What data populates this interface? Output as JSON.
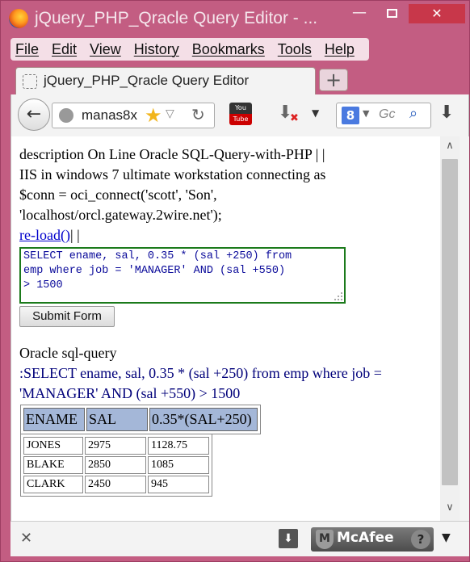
{
  "window": {
    "title": "jQuery_PHP_Qracle Query Editor - ...",
    "minimize": "—",
    "close": "✕"
  },
  "menu": {
    "items": [
      "File",
      "Edit",
      "View",
      "History",
      "Bookmarks",
      "Tools",
      "Help"
    ]
  },
  "tab": {
    "title": "jQuery_PHP_Qracle Query Editor",
    "new_tab": "+"
  },
  "nav": {
    "url": "manas8x",
    "search_placeholder": "Gc",
    "search_engine": "8",
    "youtube_top": "You",
    "youtube_bottom": "Tube"
  },
  "content": {
    "desc_line1": "description On Line Oracle SQL-Query-with-PHP | |",
    "desc_line2": "IIS in windows 7 ultimate workstation connecting as",
    "desc_line3": "$conn = oci_connect('scott', 'Son',",
    "desc_line4": "'localhost/orcl.gateway.2wire.net');",
    "reload_link": "re-load()",
    "reload_suffix": "| |",
    "query_text": "SELECT ename, sal, 0.35 * (sal +250) from\nemp where job = 'MANAGER' AND (sal +550)\n> 1500",
    "submit_label": "Submit Form",
    "result_heading": "Oracle sql-query",
    "query_line1": ":SELECT ename, sal, 0.35 * (sal +250) from emp where job =",
    "query_line2": "'MANAGER' AND (sal +550) > 1500",
    "table": {
      "headers": [
        "ENAME",
        "SAL",
        "0.35*(SAL+250)"
      ],
      "rows": [
        [
          "JONES",
          "2975",
          "1128.75"
        ],
        [
          "BLAKE",
          "2850",
          "1085"
        ],
        [
          "CLARK",
          "2450",
          "945"
        ]
      ]
    }
  },
  "addon": {
    "close": "✕",
    "mcafee": "McAfee",
    "help": "?"
  },
  "colors": {
    "window_frame": "#c35d82",
    "textarea_border": "#1b7a1b",
    "header_cell": "#a4b7d8",
    "link": "#0000cc"
  }
}
